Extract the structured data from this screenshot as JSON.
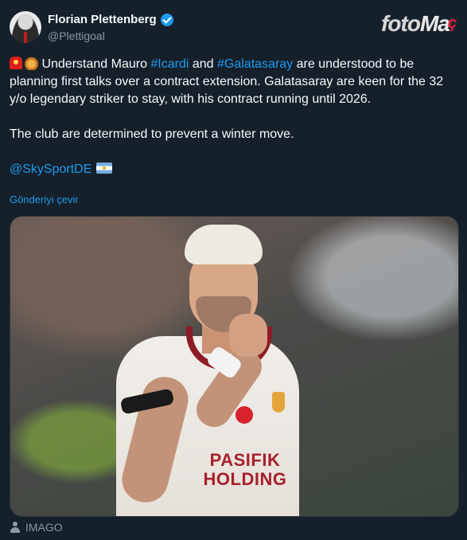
{
  "author": {
    "name": "Florian Plettenberg",
    "handle": "@Plettigoal",
    "verified": true
  },
  "watermark": {
    "part1": "foto",
    "part2": "Ma",
    "part3": "ç"
  },
  "tweet": {
    "line1_pre": " Understand Mauro ",
    "hashtag1": "#Icardi",
    "line1_mid": " and ",
    "hashtag2": "#Galatasaray",
    "line1_post": " are understood to be planning first talks over a contract extension. Galatasaray are keen for the 32 y/o legendary striker to stay, with his contract running until 2026.",
    "line2": "The club are determined to prevent a winter move.",
    "mention": "@SkySportDE"
  },
  "translate_label": "Gönderiyi çevir",
  "media": {
    "sponsor_line1": "PASIFIK",
    "sponsor_line2": "HOLDING"
  },
  "credit": "IMAGO",
  "colors": {
    "background": "#15202b",
    "link": "#1d9bf0",
    "muted": "#8b98a5",
    "brand_red": "#e0142f"
  }
}
